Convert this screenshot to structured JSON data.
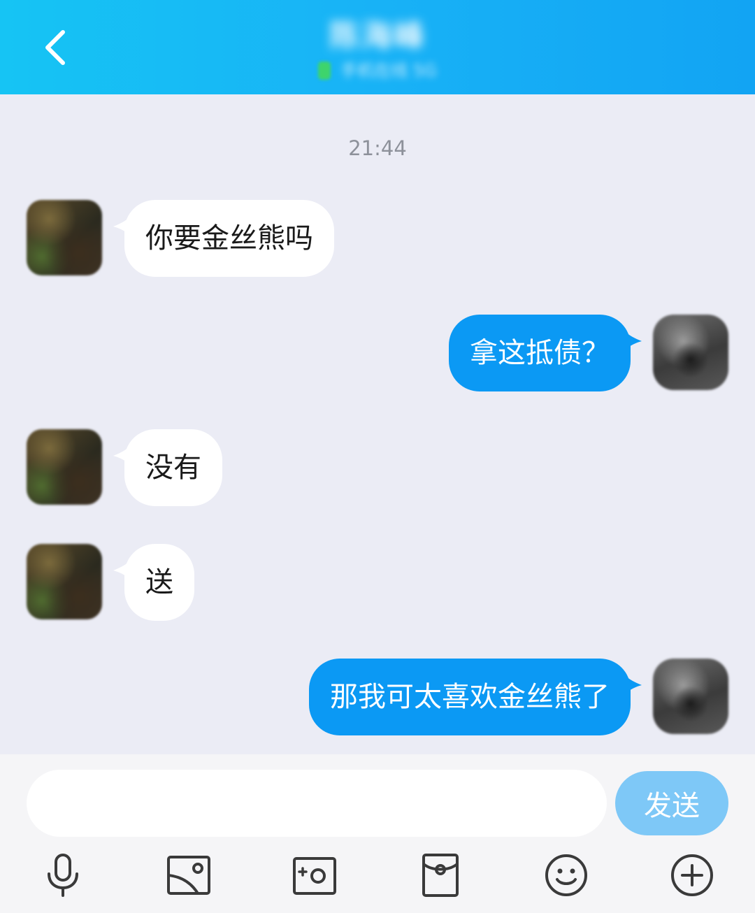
{
  "header": {
    "title": "陈海峰",
    "subtitle": "手机在线 5G"
  },
  "chat": {
    "timestamp": "21:44",
    "messages": [
      {
        "side": "left",
        "text": "你要金丝熊吗"
      },
      {
        "side": "right",
        "text": "拿这抵债？"
      },
      {
        "side": "left",
        "text": "没有"
      },
      {
        "side": "left",
        "text": "送"
      },
      {
        "side": "right",
        "text": "那我可太喜欢金丝熊了"
      }
    ]
  },
  "input": {
    "value": "",
    "placeholder": "",
    "send_label": "发送"
  },
  "toolbar": {
    "icons": [
      "microphone-icon",
      "image-icon",
      "camera-icon",
      "red-packet-icon",
      "emoji-icon",
      "plus-icon"
    ]
  },
  "colors": {
    "header": "#18b2f6",
    "outgoing_bubble": "#0b99f4",
    "incoming_bubble": "#ffffff",
    "send_button": "#7ec8f7",
    "background": "#ebecf5"
  }
}
